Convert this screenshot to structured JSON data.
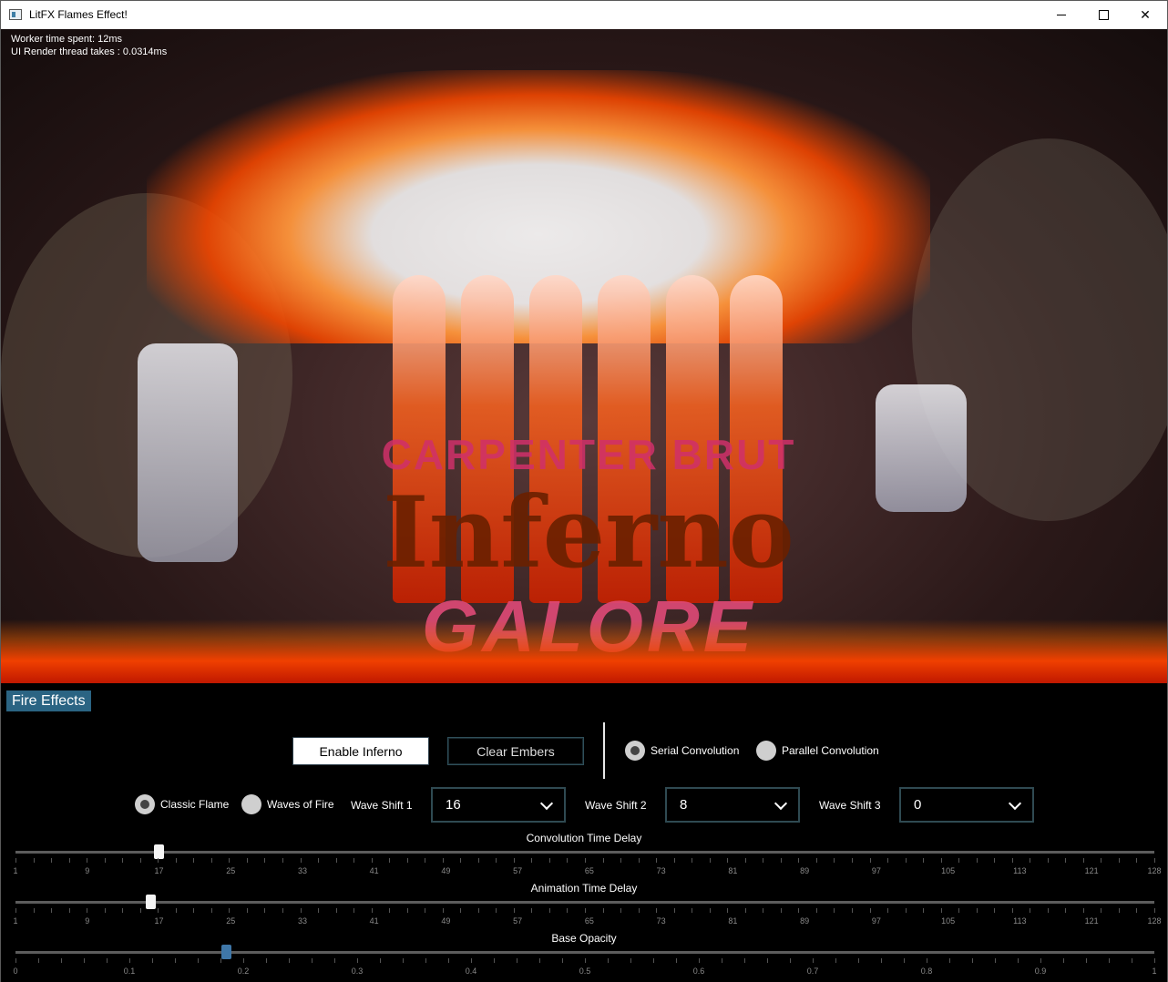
{
  "window": {
    "title": "LitFX Flames Effect!",
    "controls": {
      "minimize": "minimize",
      "maximize": "maximize",
      "close": "✕"
    }
  },
  "stats": {
    "worker": "Worker time spent: 12ms",
    "render": "UI Render thread takes : 0.0314ms"
  },
  "artwork": {
    "artist": "CARPENTER BRUT",
    "album": "Inferno",
    "album_sub": "GALORE"
  },
  "panel": {
    "tab": "Fire Effects",
    "buttons": {
      "enable": "Enable Inferno",
      "clear": "Clear Embers"
    },
    "convolution": {
      "serial": "Serial Convolution",
      "parallel": "Parallel Convolution",
      "selected": "serial"
    },
    "flame_mode": {
      "classic": "Classic Flame",
      "waves": "Waves of Fire",
      "selected": "classic"
    },
    "wave_shift_1": {
      "label": "Wave Shift 1",
      "value": "16"
    },
    "wave_shift_2": {
      "label": "Wave Shift 2",
      "value": "8"
    },
    "wave_shift_3": {
      "label": "Wave Shift 3",
      "value": "0"
    }
  },
  "sliders": {
    "convolution": {
      "title": "Convolution Time Delay",
      "value": 17,
      "min": 1,
      "max": 128,
      "ticks": [
        "1",
        "9",
        "17",
        "25",
        "33",
        "41",
        "49",
        "57",
        "65",
        "73",
        "81",
        "89",
        "97",
        "105",
        "113",
        "121",
        "128"
      ]
    },
    "animation": {
      "title": "Animation Time Delay",
      "value": 16,
      "min": 1,
      "max": 128,
      "ticks": [
        "1",
        "9",
        "17",
        "25",
        "33",
        "41",
        "49",
        "57",
        "65",
        "73",
        "81",
        "89",
        "97",
        "105",
        "113",
        "121",
        "128"
      ]
    },
    "opacity": {
      "title": "Base Opacity",
      "value": 0.185,
      "min": 0,
      "max": 1,
      "ticks": [
        "0",
        "0.1",
        "0.2",
        "0.3",
        "0.4",
        "0.5",
        "0.6",
        "0.7",
        "0.8",
        "0.9",
        "1"
      ]
    }
  },
  "colors": {
    "accent": "#2b6483",
    "thumb_accent": "#3f77a8",
    "flame": "#f04000"
  }
}
